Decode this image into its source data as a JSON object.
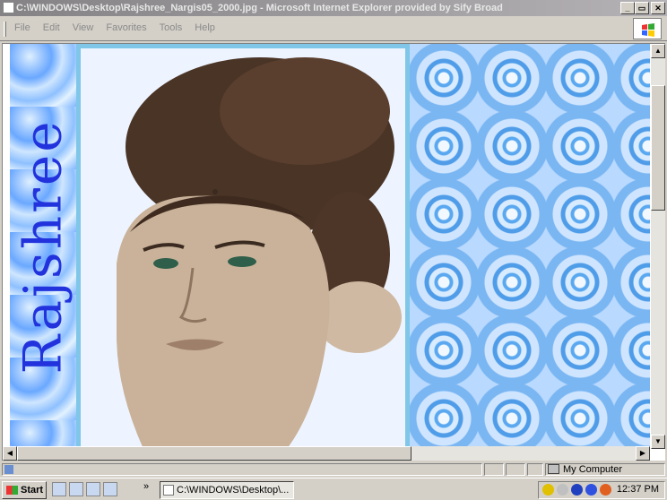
{
  "window": {
    "title": "C:\\WINDOWS\\Desktop\\Rajshree_Nargis05_2000.jpg - Microsoft Internet Explorer provided by Sify Broad",
    "buttons": {
      "minimize": "_",
      "maximize": "▭",
      "close": "✕"
    }
  },
  "menubar": {
    "items": [
      {
        "label": "File"
      },
      {
        "label": "Edit"
      },
      {
        "label": "View"
      },
      {
        "label": "Favorites"
      },
      {
        "label": "Tools"
      },
      {
        "label": "Help"
      }
    ]
  },
  "content": {
    "vertical_text": "Rajshree",
    "icons": {
      "photo": "portrait-photo",
      "roses": "blue-rose-pattern"
    }
  },
  "statusbar": {
    "zone": "My Computer"
  },
  "taskbar": {
    "start_label": "Start",
    "chevron": "»",
    "task_label": "C:\\WINDOWS\\Desktop\\...",
    "clock": "12:37 PM"
  },
  "colors": {
    "title_gradient_start": "#848284",
    "accent_text": "#2233dd",
    "frame": "#7fc6e8"
  }
}
